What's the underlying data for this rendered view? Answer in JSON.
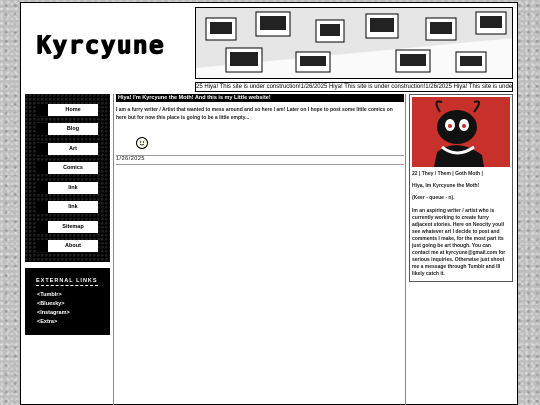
{
  "site": {
    "title": "Kyrcyune"
  },
  "marquee": "25 Hiya! This site is under construction!1/26/2025 Hiya! This site is under construction!1/26/2025 Hiya! This site is under construction!1/26/2025",
  "nav": [
    {
      "label": "Home"
    },
    {
      "label": "Blog"
    },
    {
      "label": "Art"
    },
    {
      "label": "Comics"
    },
    {
      "label": "link"
    },
    {
      "label": "link"
    },
    {
      "label": "Sitemap"
    },
    {
      "label": "About"
    }
  ],
  "external": {
    "title": "EXTERNAL LINKS",
    "links": [
      "<Tumblr>",
      "<Bluesky>",
      "<Instagram>",
      "<Extra>"
    ]
  },
  "post": {
    "title": "Hiya! I'm Kyrcyune the Moth! And this is my Little website!",
    "body": "I am a furry writer / Artist that wanted to mess around and so here I am! Later on I hope to post some little comics on here but for now this place is going to be a little empty...",
    "date": "1/26/2025"
  },
  "profile": {
    "meta": "22 | They / Them | Goth Moth |",
    "greeting": "Hiya, Im Kyrcyune the Moth!",
    "pronunciation": "(Keer - queue - n).",
    "bio": "Im an aspiring writer / artist who is currently working to create furry adjacent stories. Here on Neocity youll see whatever art I decide to post and comments I make, for the most part its just going be art though. You can contact me at kyrcyune@gmail.com for serious inquiries. Otherwise just shoot me a message through Tumblr and Ill likely catch it."
  },
  "colors": {
    "profile_bg": "#c8302c",
    "accent": "#000000"
  }
}
